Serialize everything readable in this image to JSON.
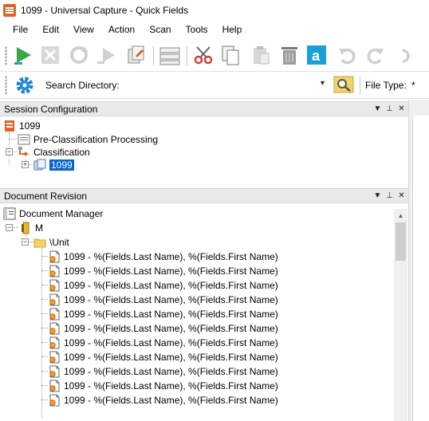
{
  "window": {
    "title": "1099 - Universal Capture - Quick Fields"
  },
  "menu": [
    "File",
    "Edit",
    "View",
    "Action",
    "Scan",
    "Tools",
    "Help"
  ],
  "toolbar": {
    "buttons": [
      "run-icon",
      "stop-icon",
      "refresh-icon",
      "run-step-icon",
      "export-icon",
      "list-icon",
      "cut-icon",
      "copy-icon",
      "paste-icon",
      "delete-icon",
      "text-a-icon",
      "undo-icon",
      "redo-icon",
      "more-icon"
    ],
    "accent": "#1aa0d8"
  },
  "search": {
    "label": "Search Directory:",
    "value": "",
    "file_type_label": "File Type:",
    "file_type_value": "*"
  },
  "session_panel": {
    "title": "Session Configuration",
    "root": "1099",
    "pre_processing": "Pre-Classification Processing",
    "classification": "Classification",
    "selected_doc": "1099"
  },
  "revision_panel": {
    "title": "Document Revision",
    "root": "Document Manager",
    "drive": "M",
    "folder": "\\Unit",
    "items": [
      "1099 - %(Fields.Last Name), %(Fields.First Name)",
      "1099 - %(Fields.Last Name), %(Fields.First Name)",
      "1099 - %(Fields.Last Name), %(Fields.First Name)",
      "1099 - %(Fields.Last Name), %(Fields.First Name)",
      "1099 - %(Fields.Last Name), %(Fields.First Name)",
      "1099 - %(Fields.Last Name), %(Fields.First Name)",
      "1099 - %(Fields.Last Name), %(Fields.First Name)",
      "1099 - %(Fields.Last Name), %(Fields.First Name)",
      "1099 - %(Fields.Last Name), %(Fields.First Name)",
      "1099 - %(Fields.Last Name), %(Fields.First Name)",
      "1099 - %(Fields.Last Name), %(Fields.First Name)"
    ]
  },
  "panel_controls": {
    "dropdown": "▼",
    "pin": "📌",
    "close": "✕"
  }
}
